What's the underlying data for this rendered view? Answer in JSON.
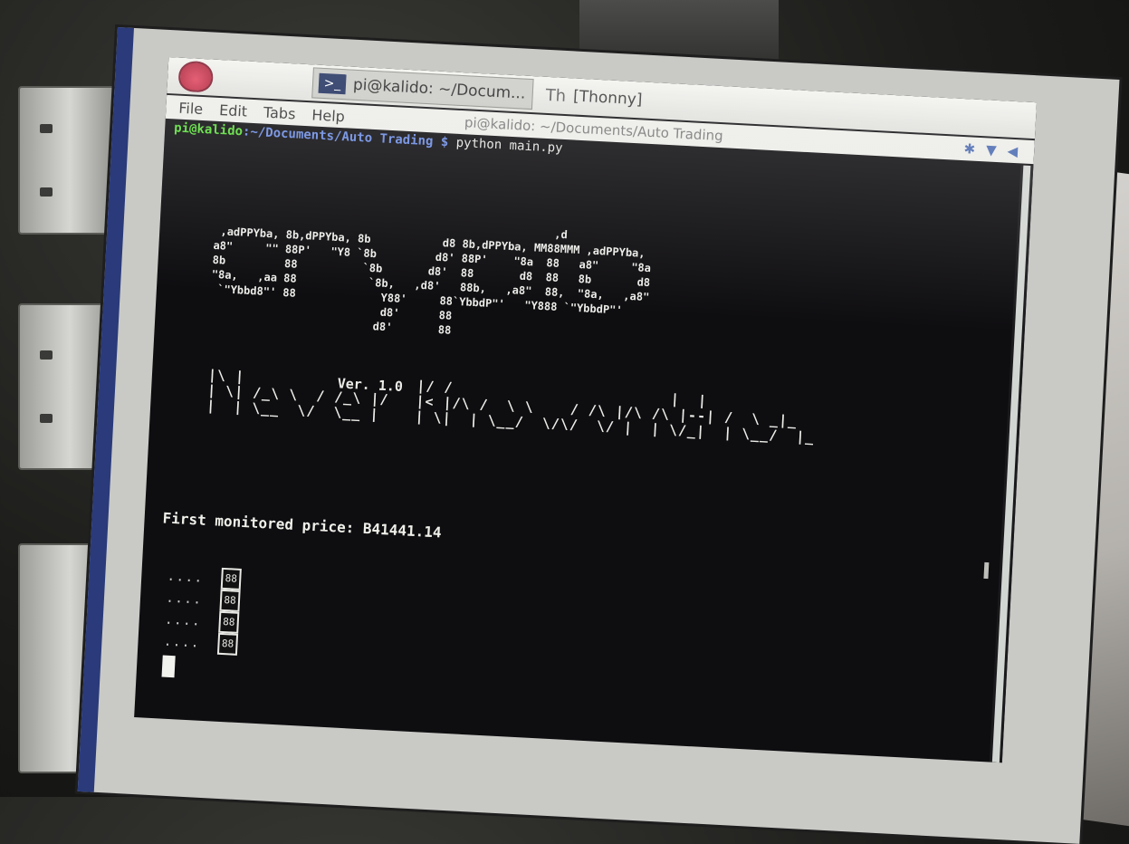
{
  "taskbar": {
    "terminal_task_label": "pi@kalido: ~/Docum...",
    "thonny_task_label": "[Thonny]",
    "terminal_icon_glyph": ">_",
    "thonny_icon_glyph": "Th"
  },
  "window": {
    "title": "pi@kalido: ~/Documents/Auto Trading",
    "menu": [
      "File",
      "Edit",
      "Tabs",
      "Help"
    ]
  },
  "terminal": {
    "prompt_user": "pi@kalido",
    "prompt_path": ":~/Documents/Auto Trading $",
    "command": " python main.py",
    "crypto_ascii": "                                                    ,d\n ,adPPYba, 8b,dPPYba, 8b           d8 8b,dPPYba, MM88MMM ,adPPYba,\na8\"     \"\" 88P'   \"Y8 `8b         d8' 88P'    \"8a  88   a8\"     \"8a\n8b         88          `8b       d8'  88       d8  88   8b       d8\n\"8a,   ,aa 88           `8b,   ,d8'   88b,   ,a8\"  88,  \"8a,   ,a8\"\n `\"Ybbd8\"' 88             Y88'     88`YbbdP\"'   \"Y888 `\"YbbdP\"'\n                          d8'      88\n                         d8'       88",
    "nkb_ascii": "|\\ |                   |/ /                        |  |\n| \\| /_\\ \\  / /_\\ |/   |< |/\\ /  \\ \\    / /\\ |/\\ /\\ |--| /  \\ _|_\n|  | \\__  \\/  \\__ |    | \\|  | \\__/  \\/\\/  \\/ |  | \\/_|  | \\__/  |_",
    "version": "Ver. 1.0",
    "first_price_label": "First monitored price: ",
    "first_price_value": "B41441.14",
    "spinner_rows": [
      {
        "dots": "....",
        "glyph": "88"
      },
      {
        "dots": "....",
        "glyph": "88"
      },
      {
        "dots": "....",
        "glyph": "88"
      },
      {
        "dots": "....",
        "glyph": "88"
      }
    ]
  },
  "colors": {
    "prompt_user": "#5adc3a",
    "prompt_path": "#6a8ae0",
    "terminal_bg": "#0e0d10",
    "terminal_fg": "#e4e4e0"
  }
}
